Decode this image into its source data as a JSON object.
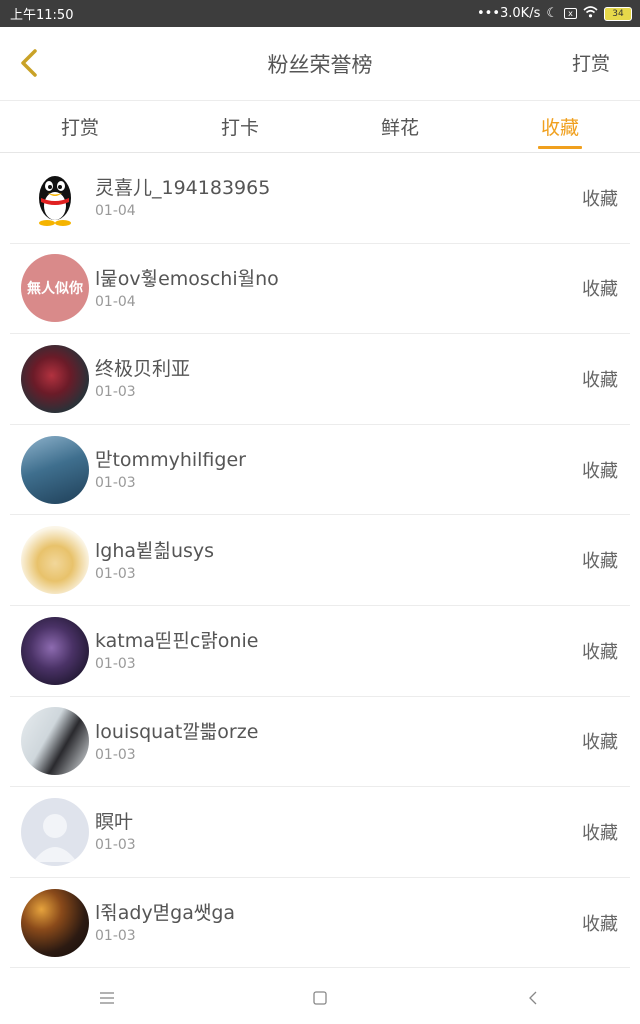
{
  "status_bar": {
    "time": "上午11:50",
    "speed": "•••3.0K/s",
    "battery": "34"
  },
  "header": {
    "title": "粉丝荣誉榜",
    "action_label": "打赏"
  },
  "tabs": [
    {
      "label": "打赏",
      "active": false
    },
    {
      "label": "打卡",
      "active": false
    },
    {
      "label": "鲜花",
      "active": false
    },
    {
      "label": "收藏",
      "active": true
    }
  ],
  "rows": [
    {
      "name": "灵喜儿_194183965",
      "date": "01-04",
      "action": "收藏"
    },
    {
      "name": "l뭁ov훻emoschi월no",
      "date": "01-04",
      "action": "收藏",
      "avatar_text": "無人似你"
    },
    {
      "name": "终极贝利亚",
      "date": "01-03",
      "action": "收藏"
    },
    {
      "name": "맏tommyhilfiger",
      "date": "01-03",
      "action": "收藏"
    },
    {
      "name": "lgha뷭칆usys",
      "date": "01-03",
      "action": "收藏"
    },
    {
      "name": "katma띧핀c랽onie",
      "date": "01-03",
      "action": "收藏"
    },
    {
      "name": "louisquat깔쁣orze",
      "date": "01-03",
      "action": "收藏"
    },
    {
      "name": "瞑叶",
      "date": "01-03",
      "action": "收藏"
    },
    {
      "name": "l쥒ady멷ga쌧ga",
      "date": "01-03",
      "action": "收藏"
    }
  ],
  "colors": {
    "accent": "#f0a01e",
    "text": "#555555",
    "subtext": "#999999"
  },
  "icons": {
    "back": "chevron-left-icon",
    "nav_menu": "menu-icon",
    "nav_home": "square-home-icon",
    "nav_back": "triangle-back-icon"
  }
}
